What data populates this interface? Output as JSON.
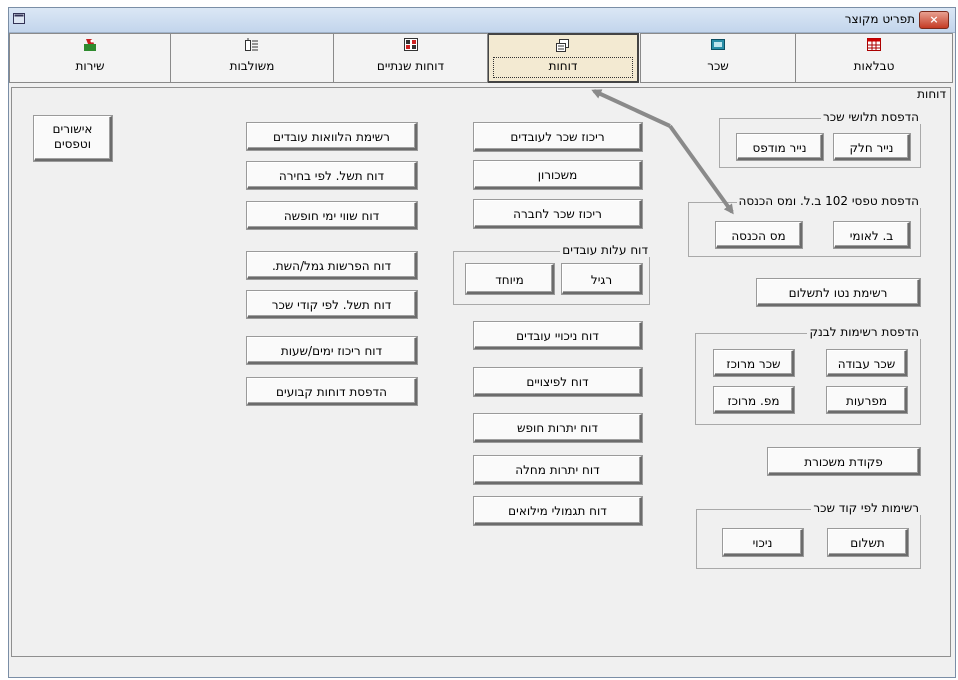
{
  "window": {
    "title": "תפריט מקוצר",
    "close_glyph": "×"
  },
  "tabs": [
    {
      "label": "טבלאות",
      "icon": "table-icon"
    },
    {
      "label": "שכר",
      "icon": "salary-icon"
    },
    {
      "label": "דוחות",
      "icon": "reports-icon",
      "active": true
    },
    {
      "label": "דוחות שנתיים",
      "icon": "annual-reports-icon"
    },
    {
      "label": "משולבות",
      "icon": "combined-icon"
    },
    {
      "label": "שירות",
      "icon": "service-icon"
    }
  ],
  "panel": {
    "title": "דוחות"
  },
  "groups": {
    "payslips": {
      "title": "הדפסת תלושי שכר",
      "plain": "נייר חלק",
      "printed": "נייר מודפס"
    },
    "forms102": {
      "title": "הדפסת טפסי 102 ב.ל. ומס הכנסה",
      "bl": "ב. לאומי",
      "tax": "מס הכנסה"
    },
    "employer_cost": {
      "title": "דוח עלות עובדים",
      "regular": "רגיל",
      "special": "מיוחד"
    },
    "bank": {
      "title": "הדפסת רשימות לבנק",
      "work_salary": "שכר עבודה",
      "central_salary": "שכר מרוכז",
      "creditors": "מפרעות",
      "central_tax": "מפ. מרוכז"
    },
    "salary_code": {
      "title": "רשימות לפי קוד שכר",
      "payment": "תשלום",
      "deduction": "ניכוי"
    }
  },
  "buttons": {
    "net_pay_list": "רשימת נטו לתשלום",
    "salary_order": "פקודת משכורת",
    "salary_summary_employees": "ריכוז שכר לעובדים",
    "payroll": "משכורון",
    "salary_summary_company": "ריכוז שכר לחברה",
    "deductions_report": "דוח ניכויי עובדים",
    "severance_report": "דוח לפיצויים",
    "vacation_balance": "דוח יתרות חופש",
    "sick_balance": "דוח יתרות מחלה",
    "reserve_pay": "דוח תגמולי מילואים",
    "employee_loans": "רשימת הלוואות עובדים",
    "payslip_by_choice": "דוח תשל. לפי בחירה",
    "vacation_value": "דוח שווי ימי חופשה",
    "pension_deposits": "דוח הפרשות גמל/השת.",
    "payslip_by_code": "דוח תשל. לפי קודי שכר",
    "days_hours": "דוח ריכוז ימים/שעות",
    "print_fixed": "הדפסת דוחות קבועים",
    "approvals_line1": "אישורים",
    "approvals_line2": "וטפסים"
  },
  "colors": {
    "annotation_arrow": "#8a8a8a",
    "active_tab_bg": "#f3ead2"
  }
}
